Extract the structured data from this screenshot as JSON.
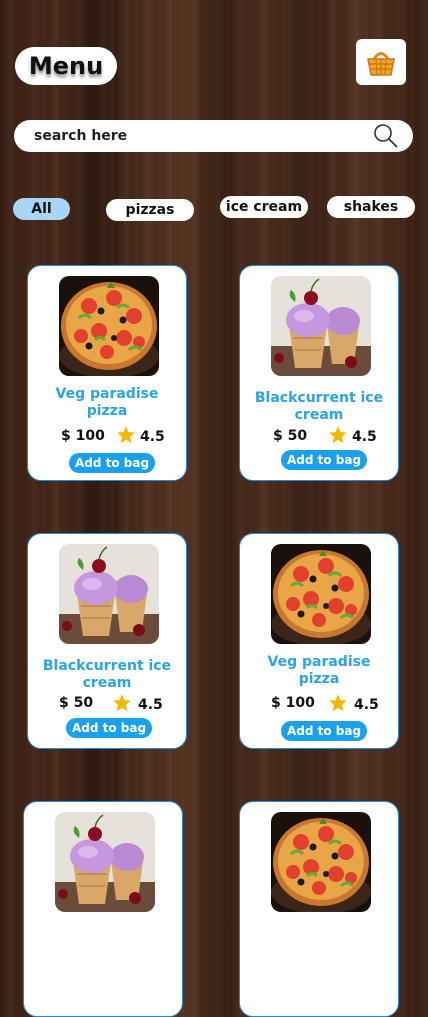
{
  "header": {
    "title": "Menu",
    "bag_icon": "basket-icon"
  },
  "search": {
    "placeholder": "search here",
    "icon": "search-icon"
  },
  "categories": [
    {
      "label": "All",
      "active": true
    },
    {
      "label": "pizzas",
      "active": false
    },
    {
      "label": "ice cream",
      "active": false
    },
    {
      "label": "shakes",
      "active": false
    }
  ],
  "products": [
    {
      "name": "Veg paradise pizza",
      "price": "$ 100",
      "rating": "4.5",
      "add_label": "Add to bag",
      "image": "pizza"
    },
    {
      "name": "Blackcurrent ice cream",
      "price": "$ 50",
      "rating": "4.5",
      "add_label": "Add to bag",
      "image": "icecream"
    },
    {
      "name": "Blackcurrent ice cream",
      "price": "$ 50",
      "rating": "4.5",
      "add_label": "Add to bag",
      "image": "icecream"
    },
    {
      "name": "Veg paradise pizza",
      "price": "$ 100",
      "rating": "4.5",
      "add_label": "Add to bag",
      "image": "pizza"
    },
    {
      "image": "icecream"
    },
    {
      "image": "pizza"
    }
  ],
  "colors": {
    "accent": "#1aa1ee",
    "title_blue": "#2aa4e6",
    "active_chip": "#a8d6f4",
    "card_border": "#1a8ed8",
    "star": "#f5b800"
  }
}
